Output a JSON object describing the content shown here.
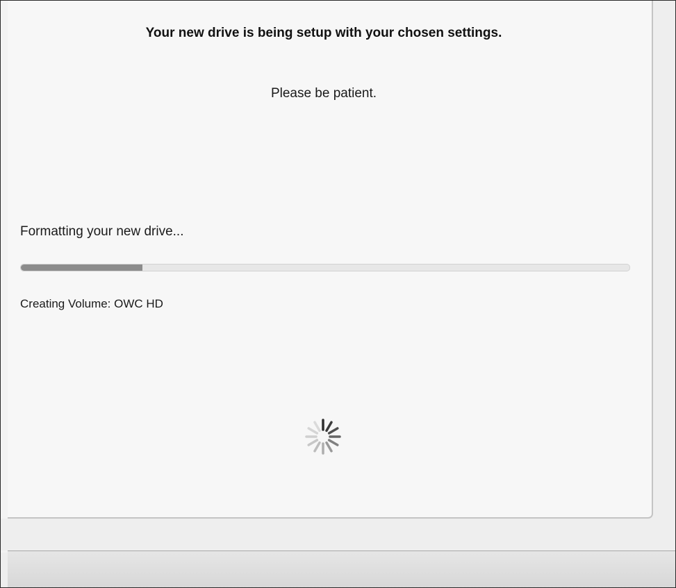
{
  "setup": {
    "headline": "Your new drive is being setup with your chosen settings.",
    "subline": "Please be patient.",
    "task_label": "Formatting your new drive...",
    "detail_label": "Creating Volume: OWC HD",
    "progress_fraction": 0.2
  },
  "icons": {
    "spinner": "loading-spinner-icon"
  },
  "colors": {
    "progress_fill": "#8c8c8c",
    "progress_track": "#e7e7e7",
    "panel_bg": "#f7f7f7"
  }
}
